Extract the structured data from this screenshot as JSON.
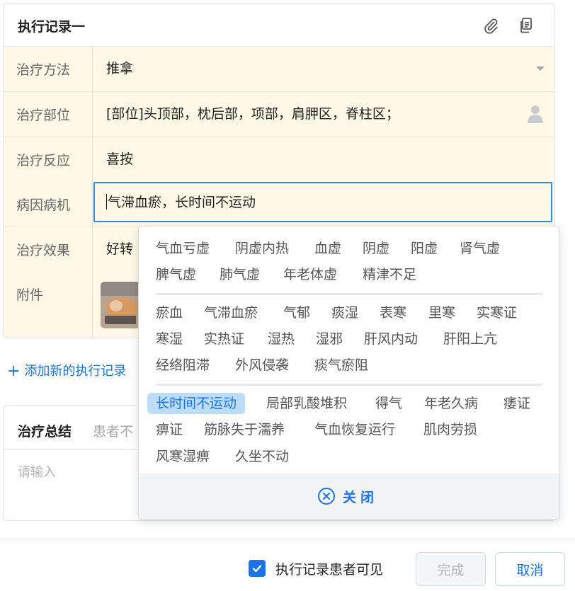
{
  "record": {
    "title": "执行记录一",
    "rows": [
      {
        "label": "治疗方法",
        "value": "推拿"
      },
      {
        "label": "治疗部位",
        "value": "[部位]头顶部，枕后部，项部，肩胛区，脊柱区；"
      },
      {
        "label": "治疗反应",
        "value": "喜按"
      },
      {
        "label": "病因病机",
        "value": "气滞血瘀，长时间不运动"
      },
      {
        "label": "治疗效果",
        "value": "好转"
      },
      {
        "label": "附件",
        "value": ""
      }
    ]
  },
  "add_record_label": "添加新的执行记录",
  "summary": {
    "title": "治疗总结",
    "note": "患者不",
    "placeholder": "请输入"
  },
  "footer": {
    "checkbox_label": "执行记录患者可见",
    "checkbox_checked": true,
    "done_label": "完成",
    "cancel_label": "取消"
  },
  "popup": {
    "groups": [
      [
        "气血亏虚",
        "阴虚内热",
        "血虚",
        "阴虚",
        "阳虚",
        "肾气虚",
        "脾气虚",
        "肺气虚",
        "年老体虚",
        "精津不足"
      ],
      [
        "瘀血",
        "气滞血瘀",
        "气郁",
        "痰湿",
        "表寒",
        "里寒",
        "实寒证",
        "寒湿",
        "实热证",
        "湿热",
        "湿邪",
        "肝风内动",
        "肝阳上亢",
        "经络阻滞",
        "外风侵袭",
        "痰气瘀阻"
      ],
      [
        "长时间不运动",
        "局部乳酸堆积",
        "得气",
        "年老久病",
        "痿证",
        "痹证",
        "筋脉失于濡养",
        "气血恢复运行",
        "肌肉劳损",
        "风寒湿痹",
        "久坐不动"
      ]
    ],
    "selected": "长时间不运动",
    "close_label": "关闭"
  },
  "colors": {
    "accent": "#1a73e8",
    "field_bg": "#fdf9e6",
    "selected_tag_bg": "#bcdcf7"
  }
}
